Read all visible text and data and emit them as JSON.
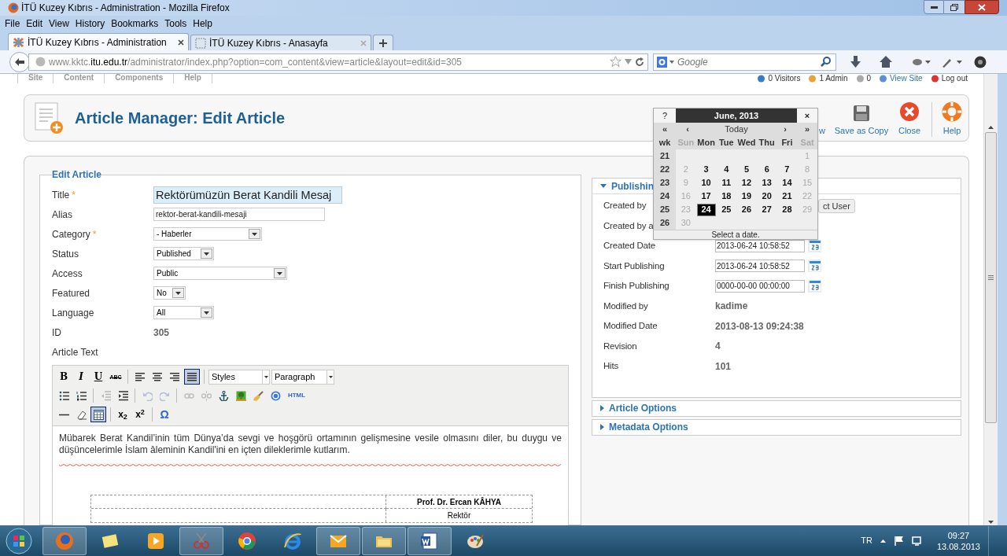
{
  "window": {
    "title": "İTÜ Kuzey Kıbrıs - Administration - Mozilla Firefox"
  },
  "menu": [
    "File",
    "Edit",
    "View",
    "History",
    "Bookmarks",
    "Tools",
    "Help"
  ],
  "tabs": [
    {
      "label": "İTÜ Kuzey Kıbrıs - Administration",
      "selected": true
    },
    {
      "label": "İTÜ Kuzey Kıbrıs - Anasayfa",
      "selected": false
    }
  ],
  "address": {
    "prefix": "www.kktc.",
    "domain": "itu.edu.tr",
    "path": "/administrator/index.php?option=com_content&view=article&layout=edit&id=305"
  },
  "search": {
    "placeholder": "Google"
  },
  "admin_menu": [
    "Site",
    "Content",
    "Components",
    "Help"
  ],
  "admin_status": [
    {
      "kind": "visitors",
      "label": "0 Visitors"
    },
    {
      "kind": "admins",
      "label": "1 Admin"
    },
    {
      "kind": "messages",
      "label": "0"
    },
    {
      "kind": "view-site",
      "label": "View Site"
    },
    {
      "kind": "logout",
      "label": "Log out"
    }
  ],
  "page_title": "Article Manager: Edit Article",
  "toolbar": [
    {
      "kind": "covered",
      "label": "w"
    },
    {
      "kind": "save-copy",
      "label": "Save as Copy"
    },
    {
      "kind": "close",
      "label": "Close"
    },
    {
      "kind": "help",
      "label": "Help"
    }
  ],
  "form": {
    "legend": "Edit Article",
    "fields": [
      {
        "label": "Title",
        "marker": "*",
        "kind": "text",
        "highlighted": true,
        "value": "Rektörümüzün Berat Kandili Mesaj"
      },
      {
        "label": "Alias",
        "kind": "text",
        "highlighted": false,
        "value": "rektor-berat-kandili-mesaji"
      },
      {
        "label": "Category",
        "marker": "*",
        "kind": "select",
        "value": "- Haberler"
      },
      {
        "label": "Status",
        "kind": "select",
        "value": "Published"
      },
      {
        "label": "Access",
        "kind": "select",
        "value": "Public"
      },
      {
        "label": "Featured",
        "kind": "select",
        "value": "No"
      },
      {
        "label": "Language",
        "kind": "select",
        "value": "All"
      },
      {
        "label": "ID",
        "kind": "static",
        "value": "305"
      }
    ],
    "editor_label": "Article Text"
  },
  "editor": {
    "toolbar_rows": [
      [
        {
          "kind": "bold",
          "label": "B",
          "selected": false,
          "disabled": false
        },
        {
          "kind": "italic",
          "label": "I",
          "selected": false,
          "disabled": false
        },
        {
          "kind": "underline",
          "label": "U",
          "selected": false,
          "disabled": false
        },
        {
          "kind": "strike",
          "label": "ABC",
          "selected": false,
          "disabled": false
        },
        {
          "kind": "sep"
        },
        {
          "kind": "align-left",
          "selected": false,
          "disabled": false
        },
        {
          "kind": "align-center",
          "selected": false,
          "disabled": false
        },
        {
          "kind": "align-right",
          "selected": false,
          "disabled": false
        },
        {
          "kind": "justify",
          "selected": true,
          "disabled": false
        },
        {
          "kind": "sep"
        },
        {
          "kind": "dropdown",
          "label": "Styles"
        },
        {
          "kind": "dropdown",
          "label": "Paragraph"
        }
      ],
      [
        {
          "kind": "bullets",
          "selected": false,
          "disabled": false
        },
        {
          "kind": "numbers",
          "selected": false,
          "disabled": false
        },
        {
          "kind": "sep"
        },
        {
          "kind": "outdent",
          "selected": false,
          "disabled": true
        },
        {
          "kind": "indent",
          "selected": false,
          "disabled": false
        },
        {
          "kind": "sep"
        },
        {
          "kind": "undo",
          "selected": false,
          "disabled": true
        },
        {
          "kind": "redo",
          "selected": false,
          "disabled": true
        },
        {
          "kind": "sep"
        },
        {
          "kind": "link",
          "selected": false,
          "disabled": true
        },
        {
          "kind": "unlink",
          "selected": false,
          "disabled": true
        },
        {
          "kind": "anchor",
          "selected": false,
          "disabled": false
        },
        {
          "kind": "image",
          "selected": false,
          "disabled": false
        },
        {
          "kind": "cleanup",
          "selected": false,
          "disabled": false
        },
        {
          "kind": "help",
          "selected": false,
          "disabled": false
        },
        {
          "kind": "html",
          "label": "HTML",
          "selected": false,
          "disabled": false
        }
      ],
      [
        {
          "kind": "hr",
          "selected": false,
          "disabled": false
        },
        {
          "kind": "eraser",
          "selected": false,
          "disabled": false
        },
        {
          "kind": "table",
          "selected": true,
          "disabled": false
        },
        {
          "kind": "sep"
        },
        {
          "kind": "sub",
          "label": "x$_{2}$",
          "selected": false,
          "disabled": false
        },
        {
          "kind": "sup",
          "label": "x$^{2}$",
          "selected": false,
          "disabled": false
        },
        {
          "kind": "sep"
        },
        {
          "kind": "charmap",
          "label": "Ω",
          "selected": false,
          "disabled": false
        }
      ]
    ],
    "paragraph": "Mübarek Berat Kandil’inin tüm Dünya’da sevgi ve hoşgörü ortamının gelişmesine vesile olmasını diler,  bu duygu ve düşüncelerimle İslam âleminin Kandil'ini en içten dileklerimle kutlarım.",
    "signature": {
      "name": "Prof. Dr. Ercan KÂHYA",
      "role": "Rektör"
    }
  },
  "publishing": {
    "title": "Publishin",
    "expanded": true,
    "rows": [
      {
        "kind": "user",
        "label": "Created by",
        "button": "ct User"
      },
      {
        "kind": "blank",
        "label": "Created by a"
      },
      {
        "kind": "date",
        "label": "Created Date",
        "value": "2013-06-24 10:58:52"
      },
      {
        "kind": "date",
        "label": "Start Publishing",
        "value": "2013-06-24 10:58:52"
      },
      {
        "kind": "date",
        "label": "Finish Publishing",
        "value": "0000-00-00 00:00:00"
      },
      {
        "kind": "static",
        "label": "Modified by",
        "value": "kadime"
      },
      {
        "kind": "static",
        "label": "Modified Date",
        "value": "2013-08-13 09:24:38"
      },
      {
        "kind": "static",
        "label": "Revision",
        "value": "4"
      },
      {
        "kind": "static",
        "label": "Hits",
        "value": "101"
      }
    ]
  },
  "panels": [
    {
      "title": "Article Options",
      "expanded": false
    },
    {
      "title": "Metadata Options",
      "expanded": false
    }
  ],
  "calendar": {
    "help": "?",
    "title": "June, 2013",
    "close": "×",
    "nav": [
      "«",
      "‹",
      "Today",
      "›",
      "»"
    ],
    "wk_label": "wk",
    "weekdays": [
      {
        "label": "Sun",
        "weekend": true
      },
      {
        "label": "Mon",
        "weekend": false
      },
      {
        "label": "Tue",
        "weekend": false
      },
      {
        "label": "Wed",
        "weekend": false
      },
      {
        "label": "Thu",
        "weekend": false
      },
      {
        "label": "Fri",
        "weekend": false
      },
      {
        "label": "Sat",
        "weekend": true
      }
    ],
    "weeks": [
      {
        "wk": "21",
        "days": [
          {
            "label": "1",
            "selected": false
          }
        ]
      },
      {
        "wk": "22",
        "days": [
          {
            "label": "2",
            "selected": false
          },
          {
            "label": "3",
            "selected": false
          },
          {
            "label": "4",
            "selected": false
          },
          {
            "label": "5",
            "selected": false
          },
          {
            "label": "6",
            "selected": false
          },
          {
            "label": "7",
            "selected": false
          },
          {
            "label": "8",
            "selected": false
          }
        ]
      },
      {
        "wk": "23",
        "days": [
          {
            "label": "9",
            "selected": false
          },
          {
            "label": "10",
            "selected": false
          },
          {
            "label": "11",
            "selected": false
          },
          {
            "label": "12",
            "selected": false
          },
          {
            "label": "13",
            "selected": false
          },
          {
            "label": "14",
            "selected": false
          },
          {
            "label": "15",
            "selected": false
          }
        ]
      },
      {
        "wk": "24",
        "days": [
          {
            "label": "16",
            "selected": false
          },
          {
            "label": "17",
            "selected": false
          },
          {
            "label": "18",
            "selected": false
          },
          {
            "label": "19",
            "selected": false
          },
          {
            "label": "20",
            "selected": false
          },
          {
            "label": "21",
            "selected": false
          },
          {
            "label": "22",
            "selected": false
          }
        ]
      },
      {
        "wk": "25",
        "days": [
          {
            "label": "23",
            "selected": false
          },
          {
            "label": "24",
            "selected": true
          },
          {
            "label": "25",
            "selected": false
          },
          {
            "label": "26",
            "selected": false
          },
          {
            "label": "27",
            "selected": false
          },
          {
            "label": "28",
            "selected": false
          },
          {
            "label": "29",
            "selected": false
          }
        ]
      },
      {
        "wk": "26",
        "days": [
          {
            "label": "30",
            "selected": false
          }
        ]
      }
    ],
    "footer": "Select a date."
  },
  "taskbar": {
    "apps": [
      {
        "kind": "browser",
        "open": true
      },
      {
        "kind": "notes",
        "open": false
      },
      {
        "kind": "media",
        "open": false
      },
      {
        "kind": "scissors",
        "open": true
      },
      {
        "kind": "wheel",
        "open": false
      },
      {
        "kind": "ring",
        "open": false
      },
      {
        "kind": "mail",
        "open": true
      },
      {
        "kind": "folder",
        "open": true
      },
      {
        "kind": "document",
        "open": true
      },
      {
        "kind": "palette",
        "open": false
      }
    ],
    "language": "TR",
    "time": "09:27",
    "date": "13.08.2013"
  }
}
